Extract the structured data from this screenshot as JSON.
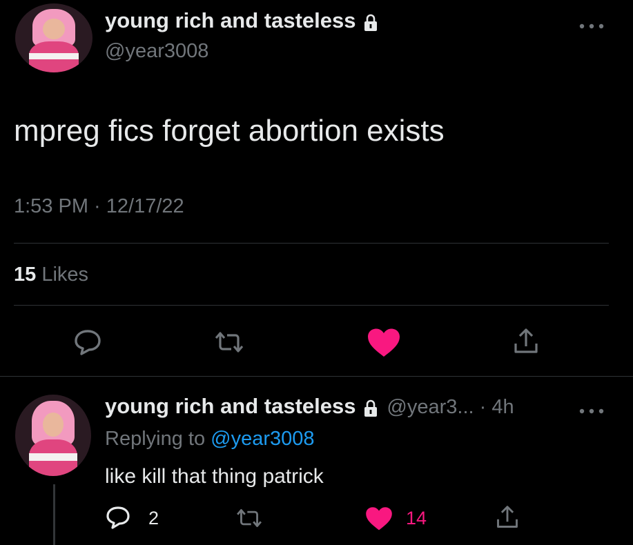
{
  "tweet": {
    "display_name": "young rich and tasteless",
    "handle": "@year3008",
    "text": "mpreg fics forget abortion exists",
    "timestamp": "1:53 PM · 12/17/22",
    "likes_count": "15",
    "likes_label": "Likes"
  },
  "reply": {
    "display_name": "young rich and tasteless",
    "handle_time": "@year3... · 4h",
    "replying_prefix": "Replying to",
    "replying_handle": "@year3008",
    "text": "like kill that thing patrick",
    "reply_count": "2",
    "like_count": "14"
  },
  "colors": {
    "background": "#000000",
    "text": "#e7e9ea",
    "muted": "#71767b",
    "link": "#1d9bf0",
    "like": "#f91880"
  }
}
